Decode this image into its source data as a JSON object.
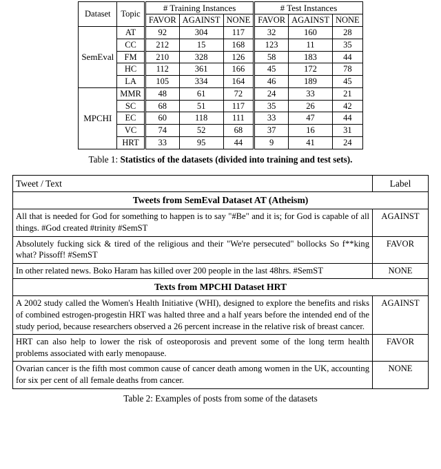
{
  "table1": {
    "headers": {
      "dataset": "Dataset",
      "topic": "Topic",
      "train_group": "# Training Instances",
      "test_group": "# Test Instances",
      "sub": [
        "FAVOR",
        "AGAINST",
        "NONE",
        "FAVOR",
        "AGAINST",
        "NONE"
      ]
    },
    "groups": [
      {
        "name": "SemEval",
        "rows": [
          {
            "topic": "AT",
            "values": [
              "92",
              "304",
              "117",
              "32",
              "160",
              "28"
            ]
          },
          {
            "topic": "CC",
            "values": [
              "212",
              "15",
              "168",
              "123",
              "11",
              "35"
            ]
          },
          {
            "topic": "FM",
            "values": [
              "210",
              "328",
              "126",
              "58",
              "183",
              "44"
            ]
          },
          {
            "topic": "HC",
            "values": [
              "112",
              "361",
              "166",
              "45",
              "172",
              "78"
            ]
          },
          {
            "topic": "LA",
            "values": [
              "105",
              "334",
              "164",
              "46",
              "189",
              "45"
            ]
          }
        ]
      },
      {
        "name": "MPCHI",
        "rows": [
          {
            "topic": "MMR",
            "values": [
              "48",
              "61",
              "72",
              "24",
              "33",
              "21"
            ]
          },
          {
            "topic": "SC",
            "values": [
              "68",
              "51",
              "117",
              "35",
              "26",
              "42"
            ]
          },
          {
            "topic": "EC",
            "values": [
              "60",
              "118",
              "111",
              "33",
              "47",
              "44"
            ]
          },
          {
            "topic": "VC",
            "values": [
              "74",
              "52",
              "68",
              "37",
              "16",
              "31"
            ]
          },
          {
            "topic": "HRT",
            "values": [
              "33",
              "95",
              "44",
              "9",
              "41",
              "24"
            ]
          }
        ]
      }
    ],
    "caption_lead": "Table 1: ",
    "caption_bold": "Statistics of the datasets (divided into training and test sets)."
  },
  "table2": {
    "headers": {
      "text": "Tweet / Text",
      "label": "Label"
    },
    "sections": [
      {
        "title": "Tweets from SemEval Dataset AT (Atheism)",
        "rows": [
          {
            "text": "All that is needed for God for something to happen is to say \"#Be\" and it is; for God is capable of all things. #God created #trinity #SemST",
            "label": "AGAINST",
            "justify": true
          },
          {
            "text": "Absolutely fucking sick & tired of the religious and their \"We're persecuted\" bollocks So f**king what? Pissoff! #SemST",
            "label": "FAVOR",
            "justify": true
          },
          {
            "text": "In other related news. Boko Haram has killed over 200 people in the last 48hrs. #SemST",
            "label": "NONE",
            "justify": true
          }
        ]
      },
      {
        "title": "Texts from MPCHI Dataset HRT",
        "rows": [
          {
            "text": "A 2002 study called the Women's Health Initiative (WHI), designed to explore the benefits and risks of combined estrogen-progestin HRT was halted three and a half years before the intended end of the study period, because researchers observed a 26 percent increase in the relative risk of breast cancer.",
            "label": "AGAINST",
            "justify": true
          },
          {
            "text": "HRT can also help to lower the risk of osteoporosis and prevent some of the long term health problems associated with early menopause.",
            "label": "FAVOR",
            "justify": true
          },
          {
            "text": "Ovarian cancer is the fifth most common cause of cancer death among women in the UK, accounting for six per cent of all female deaths from cancer.",
            "label": "NONE",
            "justify": true
          }
        ]
      }
    ],
    "caption_lead": "Table 2: ",
    "caption_bold": "Examples of posts from some of the datasets"
  }
}
